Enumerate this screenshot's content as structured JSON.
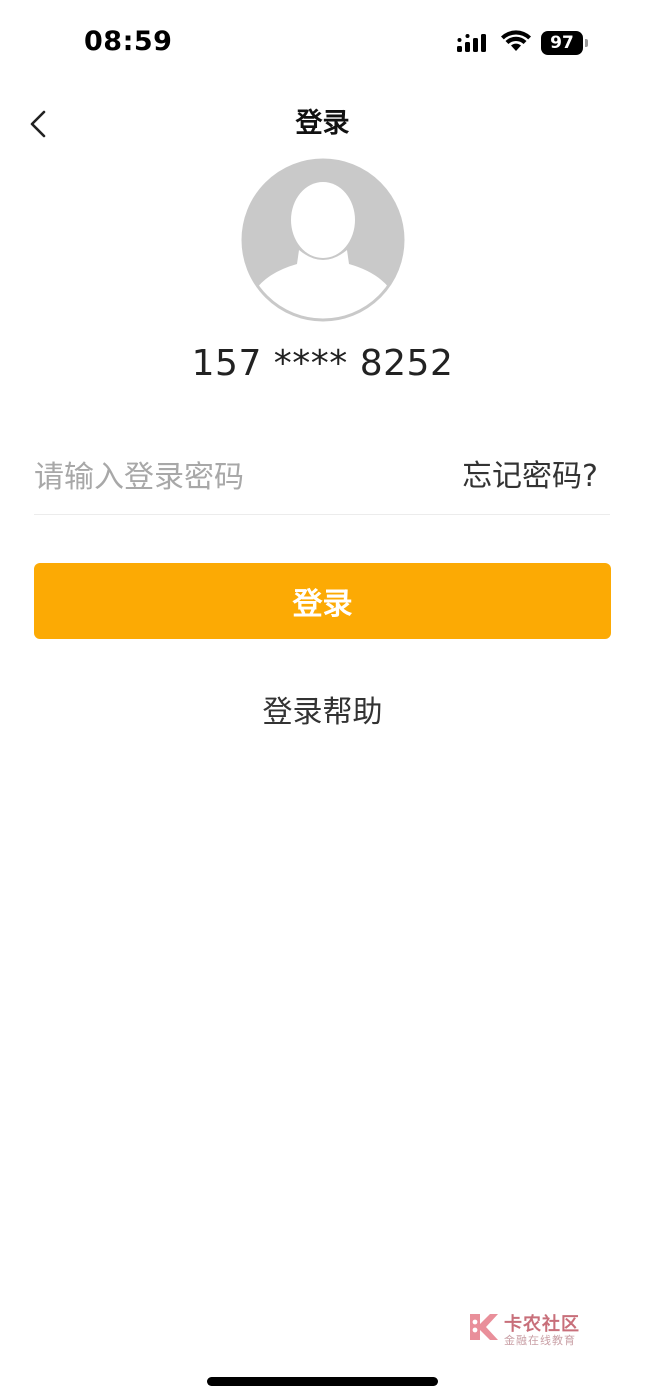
{
  "status_bar": {
    "time": "08:59",
    "battery_level": "97",
    "signal_icon": "cellular-signal-icon",
    "wifi_icon": "wifi-icon",
    "battery_icon": "battery-icon"
  },
  "nav": {
    "title": "登录",
    "back_icon": "chevron-left-icon"
  },
  "profile": {
    "avatar_icon": "default-user-avatar-icon",
    "phone_masked": "157 **** 8252"
  },
  "form": {
    "password_placeholder": "请输入登录密码",
    "password_value": "",
    "forgot_label": "忘记密码?",
    "login_label": "登录",
    "help_label": "登录帮助"
  },
  "watermark": {
    "title": "卡农社区",
    "subtitle": "金融在线教育",
    "logo_icon": "kanong-logo-icon"
  },
  "colors": {
    "accent": "#fcaa04",
    "avatar_bg": "#c9c9c9",
    "placeholder": "#a8a8a8",
    "divider": "#ececec"
  }
}
